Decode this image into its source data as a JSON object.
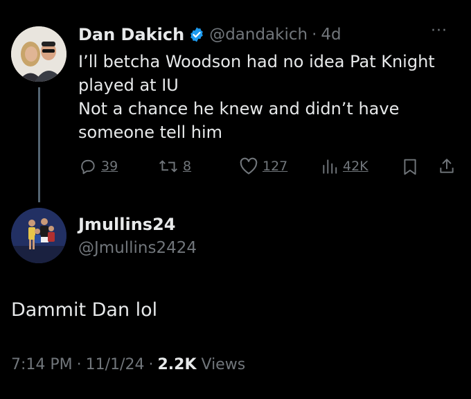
{
  "parent_tweet": {
    "display_name": "Dan Dakich",
    "handle": "@dandakich",
    "separator": "·",
    "time_ago": "4d",
    "more_menu": "···",
    "lines": [
      "I’ll betcha Woodson had no idea Pat Knight",
      "played at IU",
      "Not a chance he knew and didn’t have",
      "someone tell him"
    ],
    "actions": {
      "replies": "39",
      "reposts": "8",
      "likes": "127",
      "views": "42K"
    },
    "icons": {
      "verified": "verified-badge-icon",
      "reply": "reply-icon",
      "repost": "repost-icon",
      "like": "heart-icon",
      "views": "bar-chart-icon",
      "bookmark": "bookmark-icon",
      "share": "share-icon"
    },
    "colors": {
      "verified_badge": "#1d9bf0"
    }
  },
  "reply_tweet": {
    "display_name": "Jmullins24",
    "handle": "@Jmullins2424",
    "text": "Dammit Dan lol",
    "time": "7:14 PM",
    "date": "11/1/24",
    "separator": "·",
    "views_count": "2.2K",
    "views_label": "Views"
  }
}
